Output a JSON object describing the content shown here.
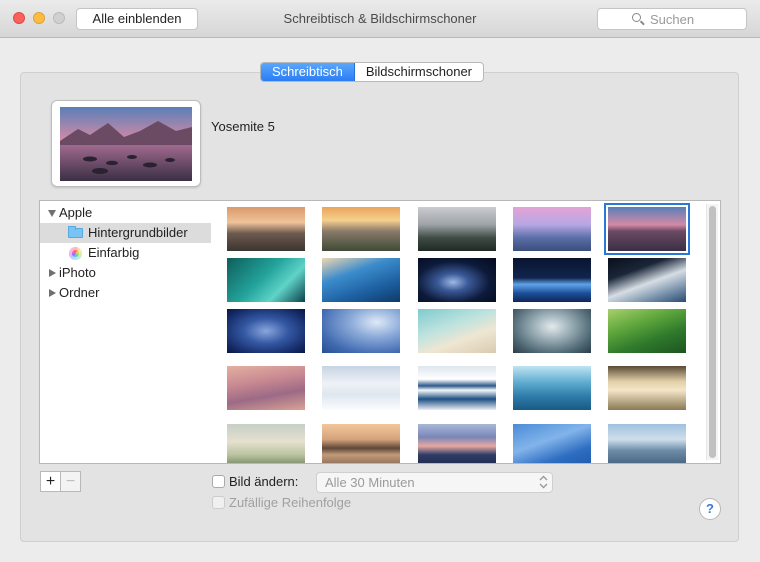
{
  "window": {
    "title": "Schreibtisch & Bildschirmschoner",
    "show_all_label": "Alle einblenden",
    "search_placeholder": "Suchen"
  },
  "tabs": [
    {
      "label": "Schreibtisch",
      "selected": true
    },
    {
      "label": "Bildschirmschoner",
      "selected": false
    }
  ],
  "current_picture": {
    "name": "Yosemite 5"
  },
  "sources": {
    "apple": {
      "label": "Apple",
      "expanded": true
    },
    "wallpapers": {
      "label": "Hintergrundbilder",
      "selected": true
    },
    "solid_colors": {
      "label": "Einfarbig"
    },
    "iphoto": {
      "label": "iPhoto",
      "expanded": false
    },
    "folders": {
      "label": "Ordner",
      "expanded": false
    }
  },
  "wallpapers": [
    {
      "theme": "half-dome-sunset",
      "selected": false
    },
    {
      "theme": "el-capitan-golden",
      "selected": false
    },
    {
      "theme": "yosemite-forest-mist",
      "selected": false
    },
    {
      "theme": "half-dome-pink-sky",
      "selected": false
    },
    {
      "theme": "yosemite-lake-rocks",
      "selected": true
    },
    {
      "theme": "green-wave",
      "selected": false
    },
    {
      "theme": "blue-wave",
      "selected": false
    },
    {
      "theme": "galaxy",
      "selected": false
    },
    {
      "theme": "earth-horizon-blue",
      "selected": false
    },
    {
      "theme": "earth-clouds",
      "selected": false
    },
    {
      "theme": "milky-way",
      "selected": false
    },
    {
      "theme": "blue-sky-moon",
      "selected": false
    },
    {
      "theme": "beach-aerial",
      "selected": false
    },
    {
      "theme": "storm-clouds",
      "selected": false
    },
    {
      "theme": "rice-terraces",
      "selected": false
    },
    {
      "theme": "pink-dunes",
      "selected": false
    },
    {
      "theme": "snow-drifts",
      "selected": false
    },
    {
      "theme": "ice-cracks",
      "selected": false
    },
    {
      "theme": "flooded-forest",
      "selected": false
    },
    {
      "theme": "misty-field",
      "selected": false
    },
    {
      "theme": "foggy-valley",
      "selected": false
    },
    {
      "theme": "island-lake",
      "selected": false
    },
    {
      "theme": "mountain-lake-dusk",
      "selected": false
    },
    {
      "theme": "blue-sky-contrail",
      "selected": false
    },
    {
      "theme": "hazy-mountains",
      "selected": false
    }
  ],
  "options": {
    "change_picture_label": "Bild ändern:",
    "change_picture_checked": false,
    "interval_value": "Alle 30 Minuten",
    "random_order_label": "Zufällige Reihenfolge",
    "random_order_enabled": false
  },
  "buttons": {
    "add": "+",
    "remove": "−",
    "help": "?"
  },
  "colors": {
    "accent": "#2a7df5",
    "selection_outline": "#2b76d9",
    "close": "#fc605c",
    "minimize": "#fdbc40"
  }
}
